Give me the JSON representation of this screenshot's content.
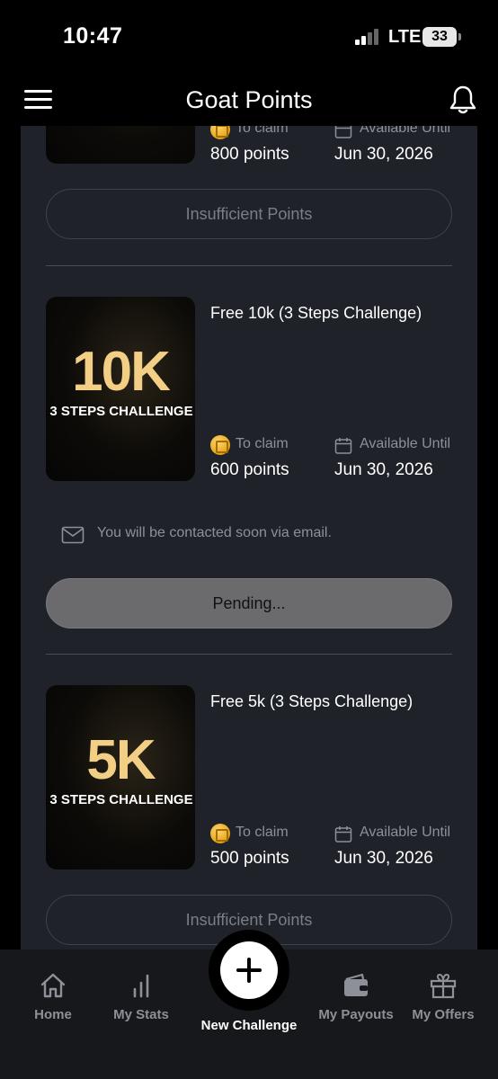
{
  "status_bar": {
    "time": "10:47",
    "network": "LTE",
    "battery": "33"
  },
  "header": {
    "title": "Goat Points",
    "menu_icon": "hamburger-menu-icon",
    "bell_icon": "bell-icon"
  },
  "labels": {
    "to_claim": "To claim",
    "available_until": "Available Until"
  },
  "cards": [
    {
      "points": "800 points",
      "date": "Jun 30, 2026",
      "button": "Insufficient Points"
    },
    {
      "title": "Free 10k (3 Steps Challenge)",
      "thumb_big": "10K",
      "thumb_sub": "3 STEPS CHALLENGE",
      "points": "600 points",
      "date": "Jun 30, 2026",
      "notice": "You will be contacted soon via email.",
      "button": "Pending..."
    },
    {
      "title": "Free 5k (3 Steps Challenge)",
      "thumb_big": "5K",
      "thumb_sub": "3 STEPS CHALLENGE",
      "points": "500 points",
      "date": "Jun 30, 2026",
      "button": "Insufficient Points"
    }
  ],
  "nav": {
    "home": "Home",
    "stats": "My Stats",
    "new_challenge": "New Challenge",
    "payouts": "My Payouts",
    "offers": "My Offers"
  },
  "colors": {
    "accent_gold": "#f2cf85",
    "card_bg": "#1f2228",
    "muted_text": "#8d9098"
  }
}
